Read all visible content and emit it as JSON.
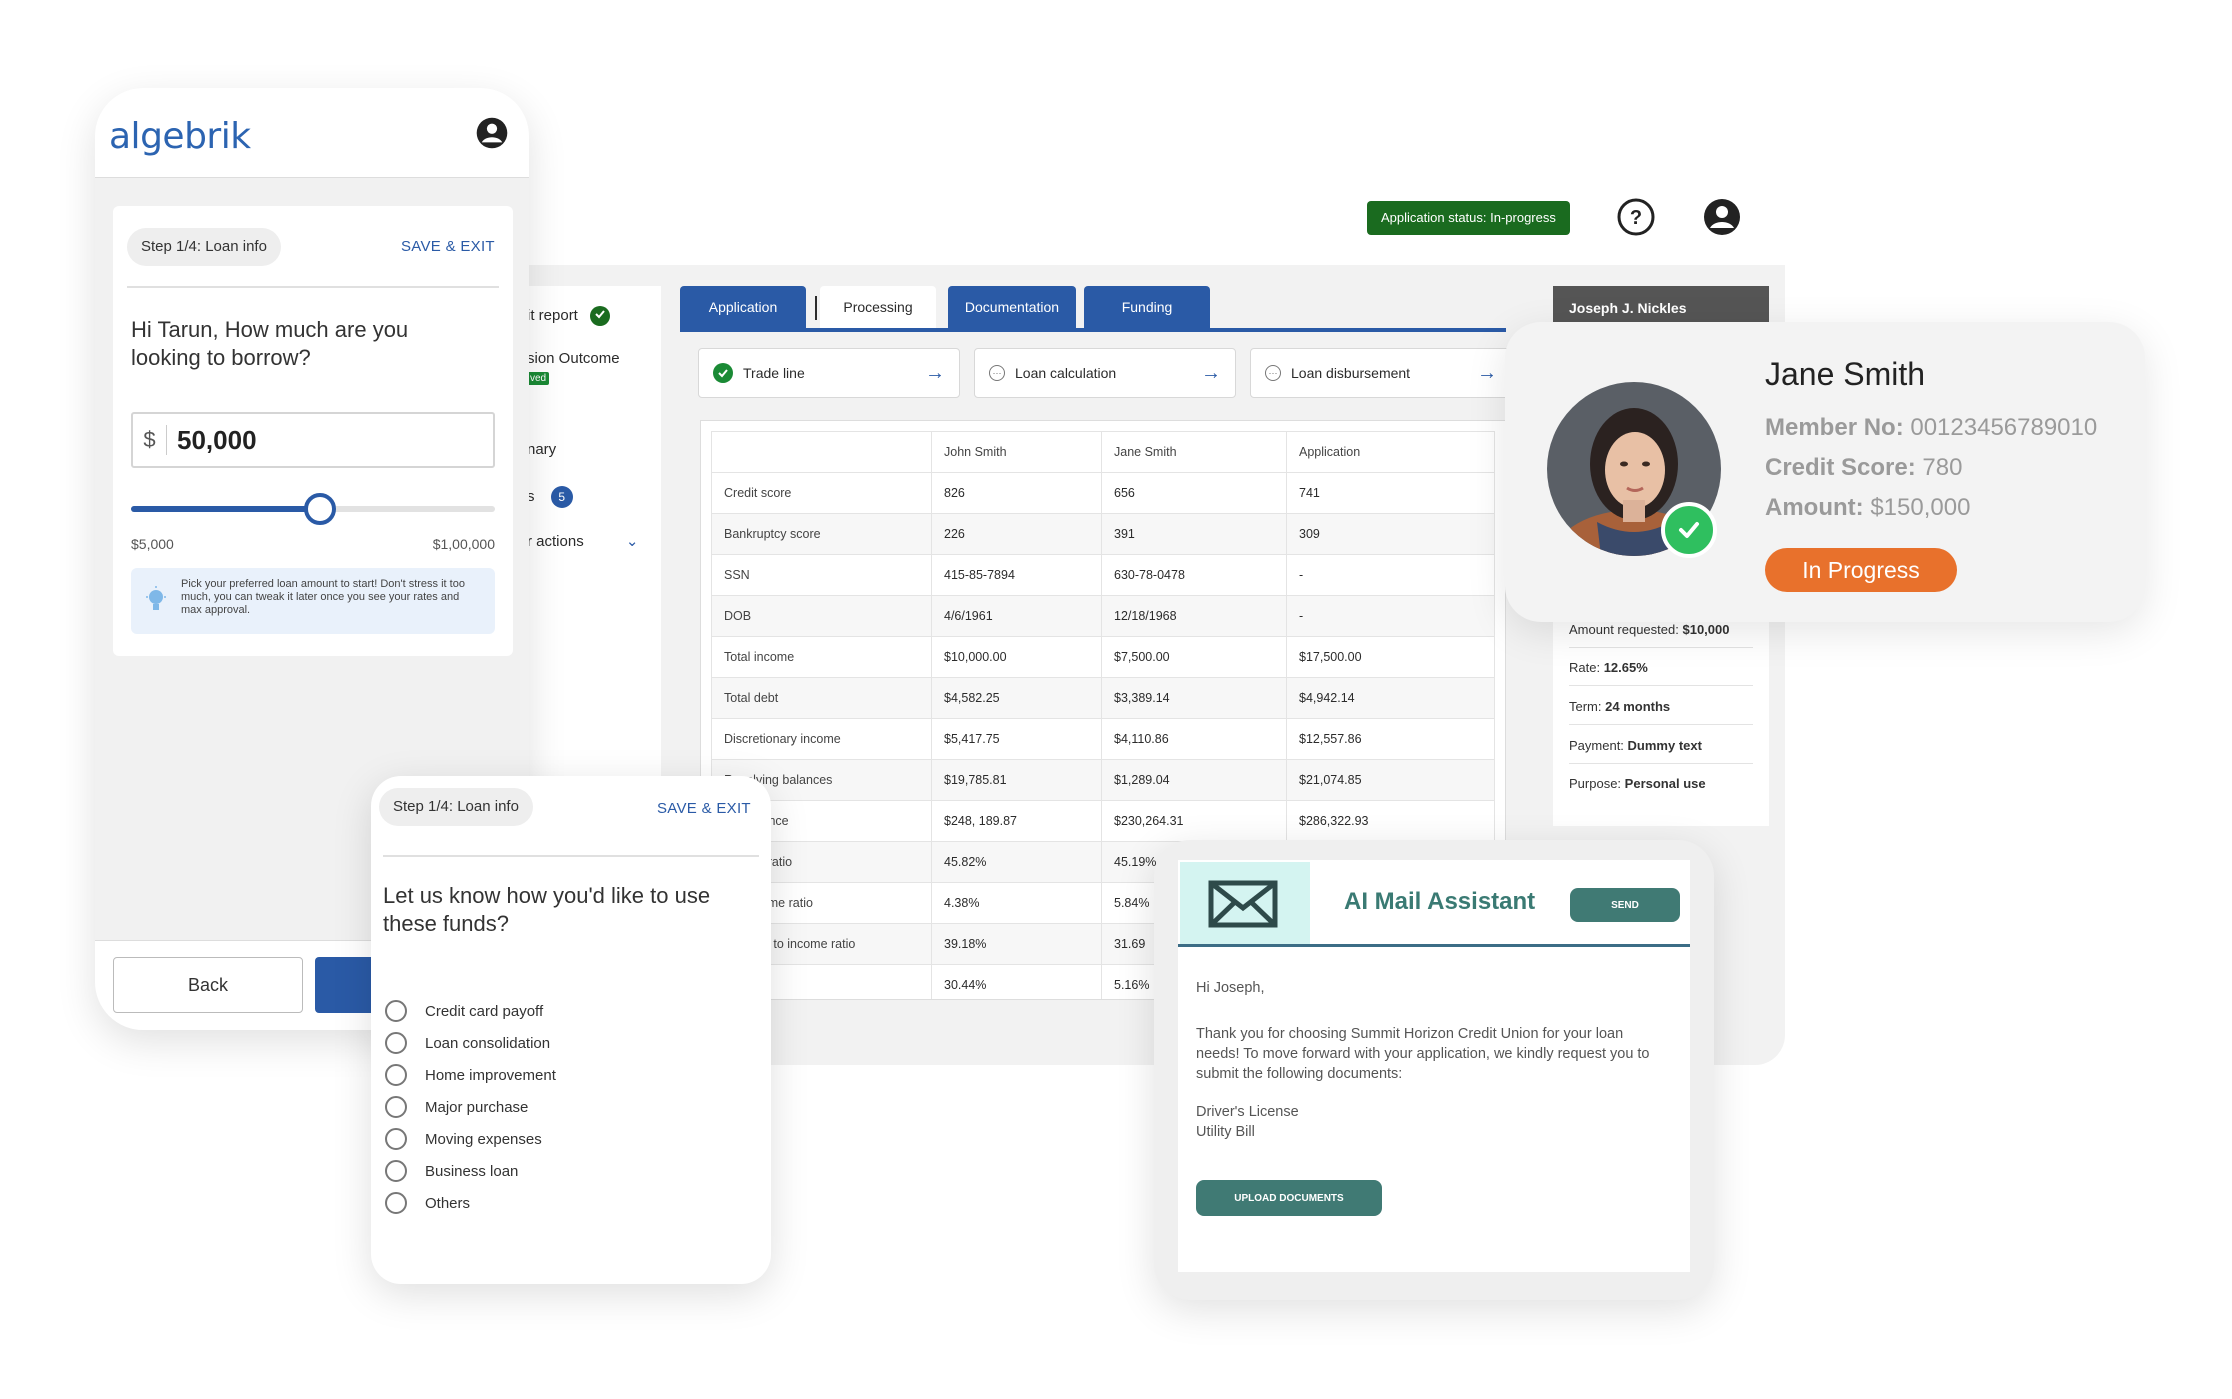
{
  "desktop": {
    "status_pill": "Application status: In-progress",
    "nav": {
      "credit_report": "it report",
      "decision_outcome": "sion Outcome",
      "approved_badge": "ved",
      "summary": "nary",
      "tasks": "s",
      "tasks_count": "5",
      "other_actions": "r actions"
    },
    "tabs": [
      "Application",
      "Processing",
      "Documentation",
      "Funding"
    ],
    "steps": [
      {
        "label": "Trade line",
        "state": "done"
      },
      {
        "label": "Loan calculation",
        "state": "pending"
      },
      {
        "label": "Loan disbursement",
        "state": "pending"
      }
    ],
    "table": {
      "headers": [
        "",
        "John Smith",
        "Jane Smith",
        "Application"
      ],
      "rows": [
        [
          "Credit score",
          "826",
          "656",
          "741"
        ],
        [
          "Bankruptcy score",
          "226",
          "391",
          "309"
        ],
        [
          "SSN",
          "415-85-7894",
          "630-78-0478",
          "-"
        ],
        [
          "DOB",
          "4/6/1961",
          "12/18/1968",
          "-"
        ],
        [
          "Total income",
          "$10,000.00",
          "$7,500.00",
          "$17,500.00"
        ],
        [
          "Total debt",
          "$4,582.25",
          "$3,389.14",
          "$4,942.14"
        ],
        [
          "Discretionary income",
          "$5,417.75",
          "$4,110.86",
          "$12,557.86"
        ],
        [
          "Revolving balances",
          "$19,785.81",
          "$1,289.04",
          "$21,074.85"
        ],
        [
          "ent balance",
          "$248, 189.87",
          "$230,264.31",
          "$286,322.93"
        ],
        [
          "income ratio",
          "45.82%",
          "45.19%",
          ""
        ],
        [
          "t to income ratio",
          "4.38%",
          "5.84%",
          ""
        ],
        [
          "red debt to income ratio",
          "39.18%",
          "31.69",
          ""
        ],
        [
          "ng ratio",
          "30.44%",
          "5.16%",
          ""
        ]
      ]
    },
    "applicant": {
      "name": "Joseph J. Nickles",
      "amount_requested_label": "Amount requested:",
      "amount_requested": "$10,000",
      "rate_label": "Rate:",
      "rate": "12.65%",
      "term_label": "Term:",
      "term": "24 months",
      "payment_label": "Payment:",
      "payment": "Dummy text",
      "purpose_label": "Purpose:",
      "purpose": "Personal use"
    }
  },
  "profile": {
    "name": "Jane Smith",
    "member_label": "Member No:",
    "member_no": "00123456789010",
    "credit_label": "Credit Score:",
    "credit_score": "780",
    "amount_label": "Amount:",
    "amount": "$150,000",
    "status": "In Progress"
  },
  "mobile": {
    "brand": "algebrik",
    "step": "Step 1/4: Loan info",
    "save_exit": "SAVE & EXIT",
    "question": "Hi Tarun, How much are you looking to borrow?",
    "currency": "$",
    "amount": "50,000",
    "slider_fraction": 0.52,
    "min": "$5,000",
    "max": "$1,00,000",
    "tip": "Pick your preferred loan amount to start! Don't stress it too much, you can tweak it later once you see your rates and max approval.",
    "back": "Back"
  },
  "funds": {
    "step": "Step 1/4: Loan info",
    "save_exit": "SAVE & EXIT",
    "question": "Let us know how you'd like to use these funds?",
    "options": [
      "Credit card payoff",
      "Loan consolidation",
      "Home improvement",
      "Major purchase",
      "Moving expenses",
      "Business loan",
      "Others"
    ]
  },
  "mail": {
    "title": "AI Mail Assistant",
    "send": "SEND",
    "greeting": "Hi Joseph,",
    "body": "Thank you for choosing Summit Horizon Credit Union for your loan needs! To move forward with your application, we kindly request you to submit the following documents:",
    "doc1": "Driver's License",
    "doc2": "Utility Bill",
    "upload": "UPLOAD DOCUMENTS"
  },
  "colors": {
    "brand_blue": "#2a5aa6",
    "success_green": "#1a8a35",
    "status_orange": "#e8712c",
    "mail_teal": "#407a74"
  }
}
